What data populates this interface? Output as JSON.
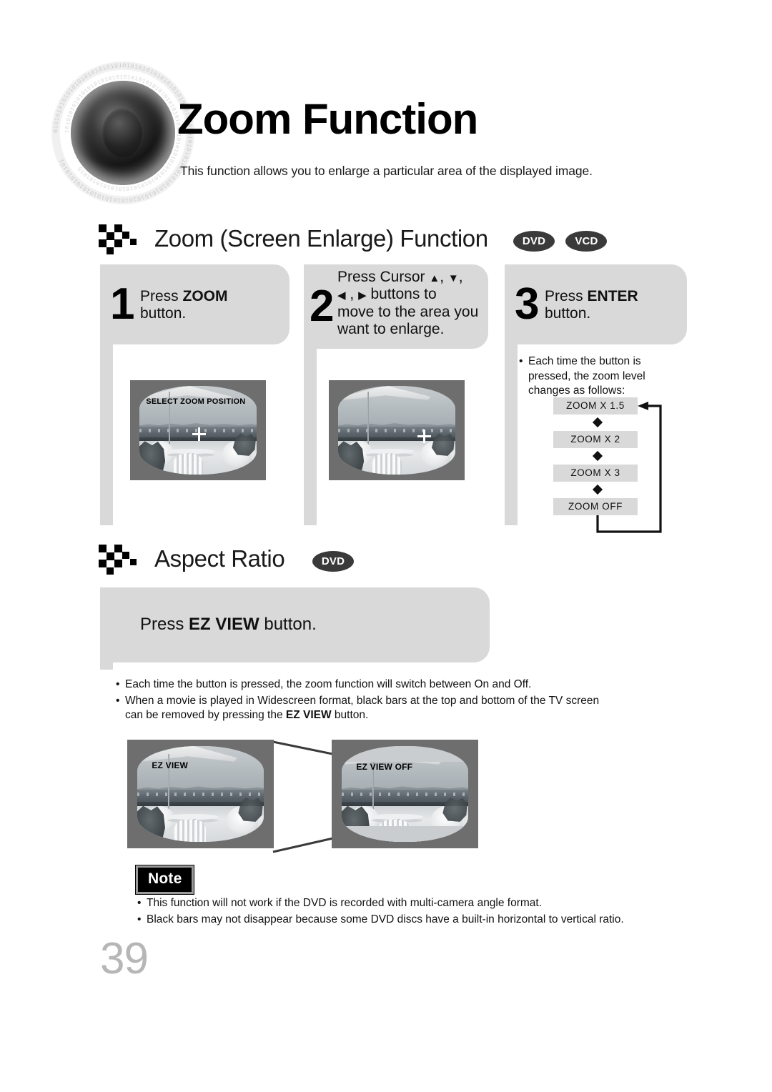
{
  "page": {
    "title": "Zoom Function",
    "subtitle": "This function allows you to enlarge a particular area of the displayed image.",
    "number": "39",
    "logo_icon": "speaker-logo-icon"
  },
  "sections": [
    {
      "id": "zoom-screen-enlarge",
      "heading": "Zoom (Screen Enlarge) Function",
      "badges": [
        "DVD",
        "VCD"
      ],
      "icon": "checkerboard-bullet-icon",
      "steps": [
        {
          "number": "1",
          "text_html": "Press <b>ZOOM</b><br>button."
        },
        {
          "number": "2",
          "text_html": "Press Cursor ▲, ▼,<br>◀ , ▶ buttons to<br>move to the area you<br>want to enlarge."
        },
        {
          "number": "3",
          "text_html": "Press <b>ENTER</b><br>button."
        }
      ],
      "screens": [
        {
          "name": "select-zoom-position-screen",
          "osd": "SELECT ZOOM POSITION",
          "crosshair": true
        },
        {
          "name": "zoom-area-moved-screen",
          "osd": "",
          "crosshair": true
        }
      ],
      "note": {
        "bullets": [
          "Each time the button is pressed, the zoom level changes as follows:"
        ]
      },
      "flow": {
        "steps": [
          "ZOOM X 1.5",
          "ZOOM X 2",
          "ZOOM X 3",
          "ZOOM OFF"
        ],
        "loops_back_to": "ZOOM X 1.5"
      }
    },
    {
      "id": "aspect-ratio",
      "heading": "Aspect Ratio",
      "badges": [
        "DVD"
      ],
      "icon": "checkerboard-bullet-icon",
      "instruction_html": "Press <b>EZ VIEW</b> button.",
      "bullets_html": [
        "Each time the button is pressed, the zoom function will switch between On and Off.",
        "When a movie is played in Widescreen format, black bars at the top and bottom of the TV screen can be removed by pressing the <b>EZ VIEW</b> button."
      ],
      "screens": [
        {
          "name": "ez-view-on-screen",
          "osd": "EZ VIEW",
          "letterbox": false
        },
        {
          "name": "ez-view-off-screen",
          "osd": "EZ VIEW OFF",
          "letterbox": true
        }
      ]
    }
  ],
  "note_block": {
    "label": "Note",
    "bullets_html": [
      "This function will not work if the DVD is recorded with multi-camera angle format.",
      "Black bars may not disappear because some DVD discs have a built-in horizontal to vertical ratio."
    ]
  },
  "colors": {
    "panel_gray": "#d9d9d9",
    "badge_dark": "#3a3a3a",
    "tv_bezel": "#6e6e6e",
    "page_number": "#b6b6b6",
    "note_badge_bg": "#000000"
  }
}
